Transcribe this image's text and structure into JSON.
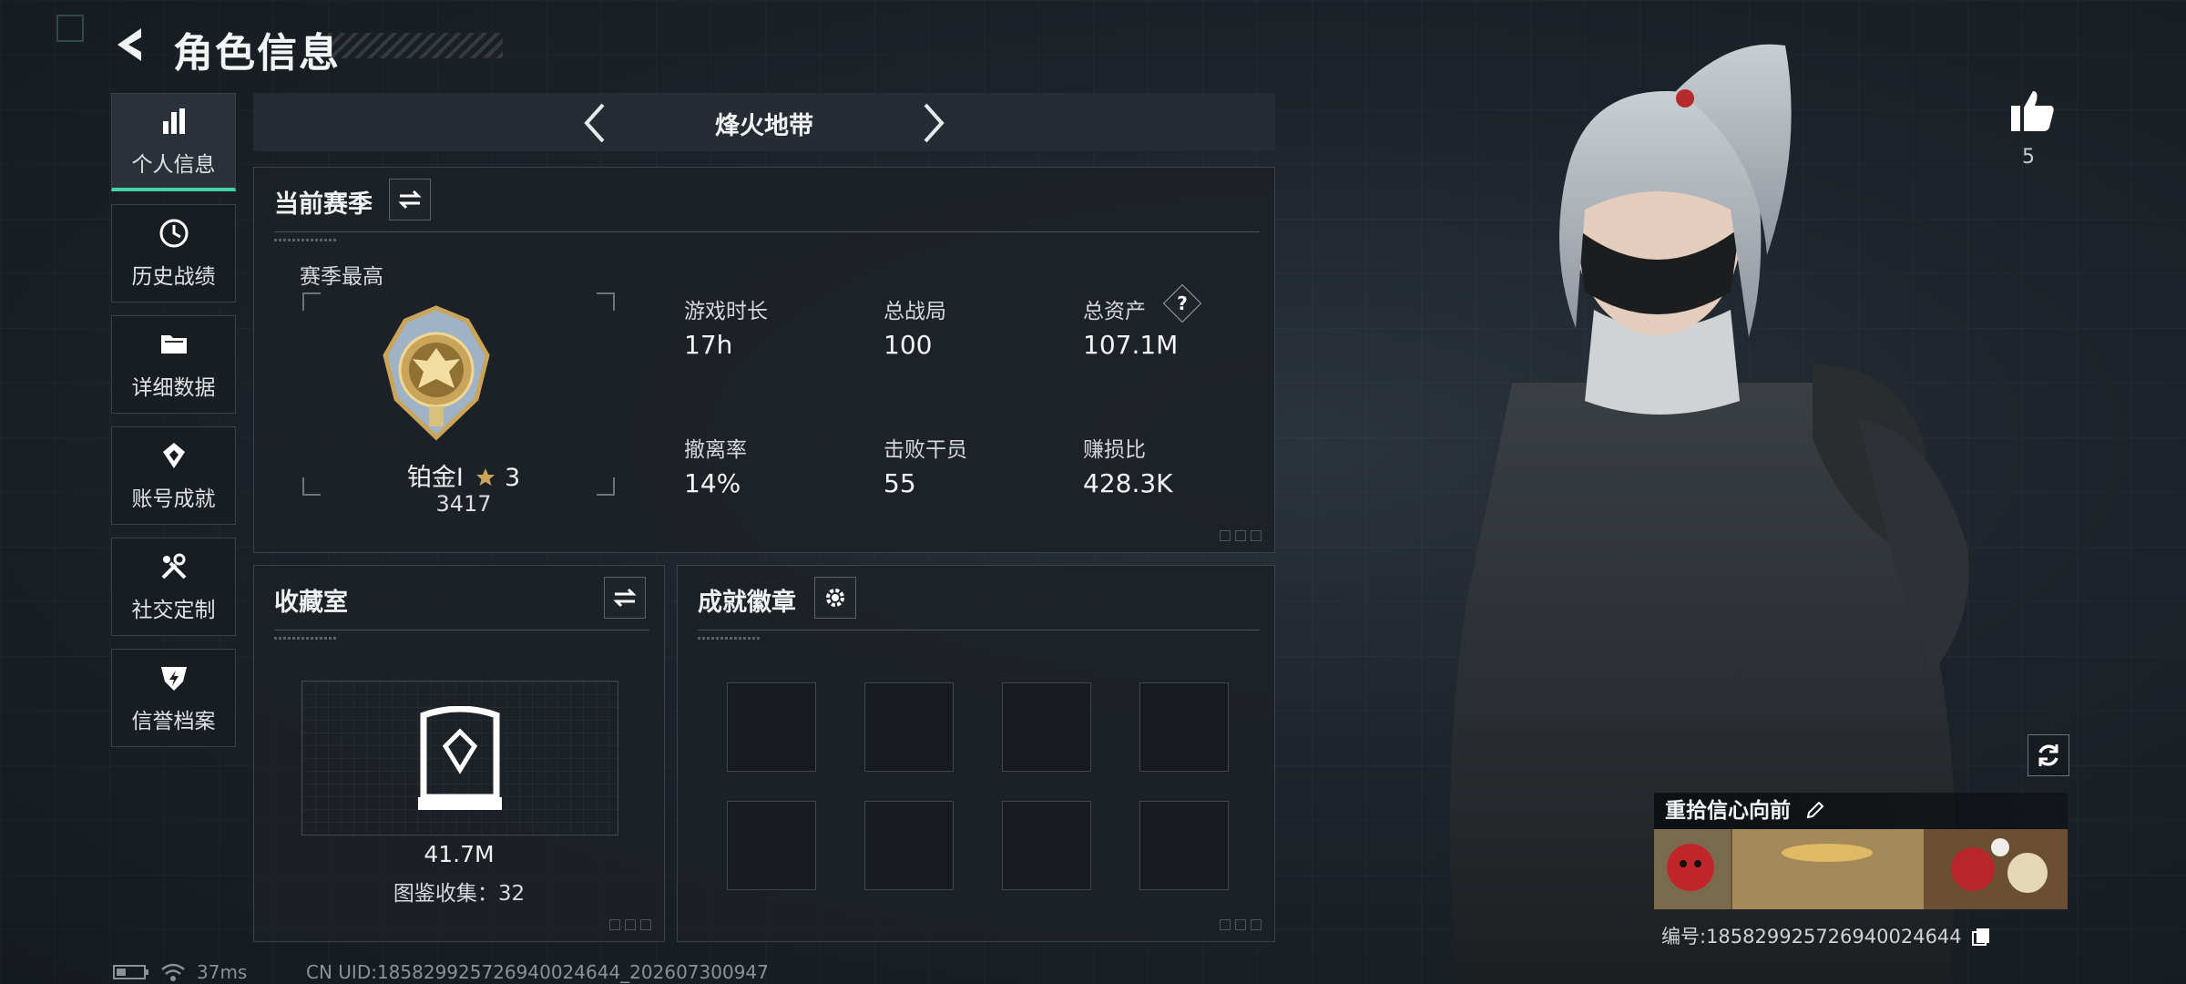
{
  "header": {
    "title": "角色信息"
  },
  "sidebar": {
    "items": [
      {
        "label": "个人信息",
        "icon": "bar-chart-icon",
        "active": true
      },
      {
        "label": "历史战绩",
        "icon": "history-clock-icon",
        "active": false
      },
      {
        "label": "详细数据",
        "icon": "folder-icon",
        "active": false
      },
      {
        "label": "账号成就",
        "icon": "achievement-icon",
        "active": false
      },
      {
        "label": "社交定制",
        "icon": "tools-icon",
        "active": false
      },
      {
        "label": "信誉档案",
        "icon": "shield-bolt-icon",
        "active": false
      }
    ]
  },
  "mode_nav": {
    "title": "烽火地带"
  },
  "season": {
    "title": "当前赛季",
    "best_label": "赛季最高",
    "rank_name": "铂金Ⅰ",
    "rank_stars": "3",
    "rank_score": "3417",
    "stats": [
      {
        "label": "游戏时长",
        "value": "17h"
      },
      {
        "label": "总战局",
        "value": "100"
      },
      {
        "label": "总资产",
        "value": "107.1M"
      },
      {
        "label": "撤离率",
        "value": "14%"
      },
      {
        "label": "击败干员",
        "value": "55"
      },
      {
        "label": "赚损比",
        "value": "428.3K"
      }
    ],
    "help_symbol": "?"
  },
  "collection": {
    "title": "收藏室",
    "value": "41.7M",
    "count_text": "图鉴收集：32"
  },
  "badges": {
    "title": "成就徽章",
    "slots": 8
  },
  "likes": {
    "count": "5"
  },
  "banner": {
    "title": "重拾信心向前",
    "id_text": "编号:1858299257269400246​44"
  },
  "status_bar": {
    "ping": "37ms",
    "cn_uid": "CN UID:185829925726940024644_202607300947"
  },
  "colors": {
    "accent": "#41d2a8",
    "rank_gold": "#c9a45a",
    "panel_bg": "#1c2127"
  }
}
